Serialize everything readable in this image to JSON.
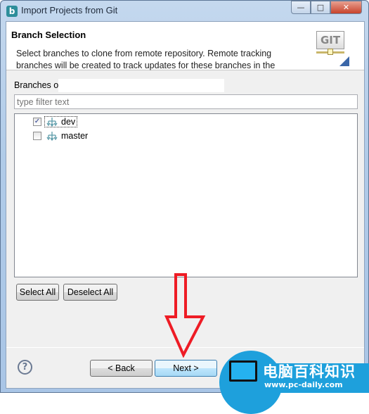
{
  "window": {
    "title": "Import Projects from Git",
    "app_icon": "b",
    "controls": {
      "minimize": "—",
      "maximize": "□",
      "close": "✕"
    }
  },
  "header": {
    "title": "Branch Selection",
    "description": "Select branches to clone from remote repository. Remote tracking branches will be created to track updates for these branches in the",
    "logo_text": "GIT"
  },
  "branches": {
    "label": "Branches o",
    "filter_placeholder": "type filter text",
    "items": [
      {
        "name": "dev",
        "checked": true,
        "check": "✓"
      },
      {
        "name": "master",
        "checked": false,
        "check": ""
      }
    ]
  },
  "buttons": {
    "select_all": "Select All",
    "deselect_all": "Deselect All",
    "back": "< Back",
    "next": "Next >",
    "help": "?"
  },
  "colors": {
    "arrow": "#ee1c25",
    "watermark": "#1ea0dc"
  },
  "watermark": {
    "text": "电脑百科知识",
    "url": "www.pc-daily.com"
  }
}
